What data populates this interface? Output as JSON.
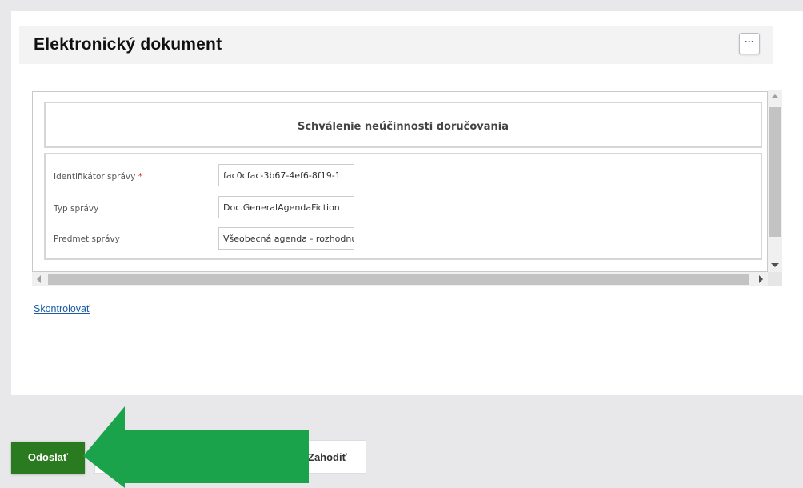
{
  "document": {
    "title": "Elektronický dokument",
    "more_label": "···",
    "form_title": "Schválenie neúčinnosti doručovania",
    "fields": [
      {
        "label": "Identifikátor správy",
        "required_mark": "*",
        "value": "fac0cfac-3b67-4ef6-8f19-1"
      },
      {
        "label": "Typ správy",
        "required_mark": "",
        "value": "Doc.GeneralAgendaFiction"
      },
      {
        "label": "Predmet správy",
        "required_mark": "",
        "value": "Všeobecná agenda - rozhodnutie"
      }
    ],
    "check_link": "Skontrolovať"
  },
  "actions": {
    "send_label": "Odoslať",
    "discard_label": "Zahodiť"
  },
  "colors": {
    "send_button": "#2a7a1f",
    "arrow": "#1aa34a",
    "link": "#1a5ba6",
    "required": "#dd2222"
  }
}
